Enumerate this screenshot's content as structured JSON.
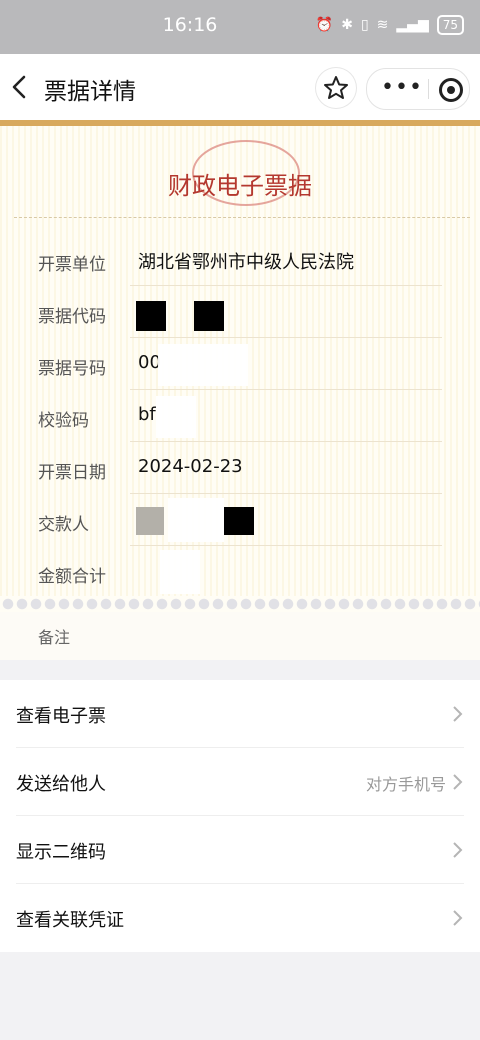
{
  "status": {
    "time": "16:16",
    "battery": "75"
  },
  "nav": {
    "title": "票据详情"
  },
  "receipt": {
    "title": "财政电子票据",
    "rows": [
      {
        "label": "开票单位",
        "value": "湖北省鄂州市中级人民法院"
      },
      {
        "label": "票据代码",
        "value": ""
      },
      {
        "label": "票据号码",
        "value": "00"
      },
      {
        "label": "校验码",
        "value": "bf"
      },
      {
        "label": "开票日期",
        "value": "2024-02-23"
      },
      {
        "label": "交款人",
        "value": ""
      },
      {
        "label": "金额合计",
        "value": ""
      }
    ],
    "notes_label": "备注"
  },
  "menu": [
    {
      "label": "查看电子票",
      "hint": ""
    },
    {
      "label": "发送给他人",
      "hint": "对方手机号"
    },
    {
      "label": "显示二维码",
      "hint": ""
    },
    {
      "label": "查看关联凭证",
      "hint": ""
    }
  ]
}
